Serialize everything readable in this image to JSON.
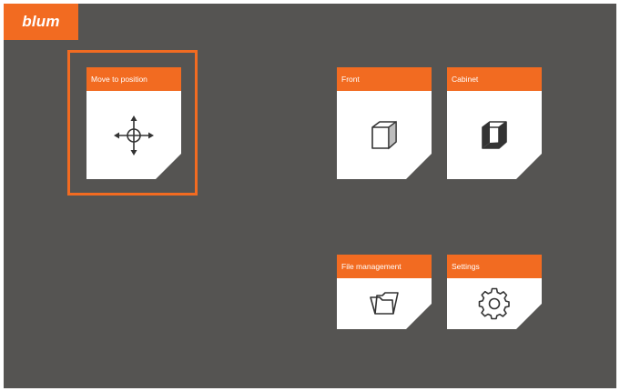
{
  "brand": {
    "logo_text": "blum",
    "accent_color": "#f26b21",
    "background_color": "#555452"
  },
  "tiles": {
    "move_to_position": {
      "label": "Move to position",
      "icon": "move-arrows-icon",
      "selected": true
    },
    "front": {
      "label": "Front",
      "icon": "cube-icon"
    },
    "cabinet": {
      "label": "Cabinet",
      "icon": "open-cabinet-icon"
    },
    "file_management": {
      "label": "File management",
      "icon": "folder-icon"
    },
    "settings": {
      "label": "Settings",
      "icon": "gear-icon"
    }
  }
}
